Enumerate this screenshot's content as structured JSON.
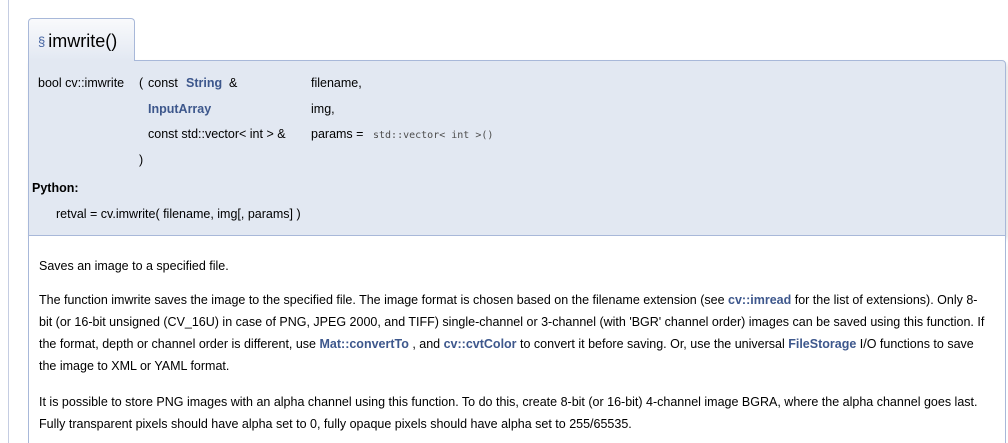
{
  "header": {
    "anchor": "§",
    "title": "imwrite()"
  },
  "prototype": {
    "return_and_name": "bool cv::imwrite",
    "open_paren": "(",
    "p1_const": "const",
    "p1_type": "String",
    "p1_amp": "&",
    "p1_name": "filename,",
    "p2_type": "InputArray",
    "p2_name": "img,",
    "p3_type": "const std::vector< int > &",
    "p3_name": "params =",
    "p3_default": "std::vector< int >()",
    "close_paren": ")"
  },
  "python": {
    "label": "Python:",
    "signature": "retval = cv.imwrite( filename, img[, params] )"
  },
  "description": {
    "p1": "Saves an image to a specified file.",
    "p2": {
      "t1": "The function imwrite saves the image to the specified file. The image format is chosen based on the filename extension (see ",
      "link_imread": "cv::imread",
      "t2": " for the list of extensions). Only 8-bit (or 16-bit unsigned (CV_16U) in case of PNG, JPEG 2000, and TIFF) single-channel or 3-channel (with 'BGR' channel order) images can be saved using this function. If the format, depth or channel order is different, use ",
      "link_convertto": "Mat::convertTo",
      "t3": " , and ",
      "link_cvtcolor": "cv::cvtColor",
      "t4": " to convert it before saving. Or, use the universal ",
      "link_filestorage": "FileStorage",
      "t5": " I/O functions to save the image to XML or YAML format."
    },
    "p3": "It is possible to store PNG images with an alpha channel using this function. To do this, create 8-bit (or 16-bit) 4-channel image BGRA, where the alpha channel goes last. Fully transparent pixels should have alpha set to 0, fully opaque pixels should have alpha set to 255/65535."
  },
  "colors": {
    "link": "#3d578c",
    "proto_bg": "#e2e8f2",
    "border": "#a8b8d9"
  }
}
